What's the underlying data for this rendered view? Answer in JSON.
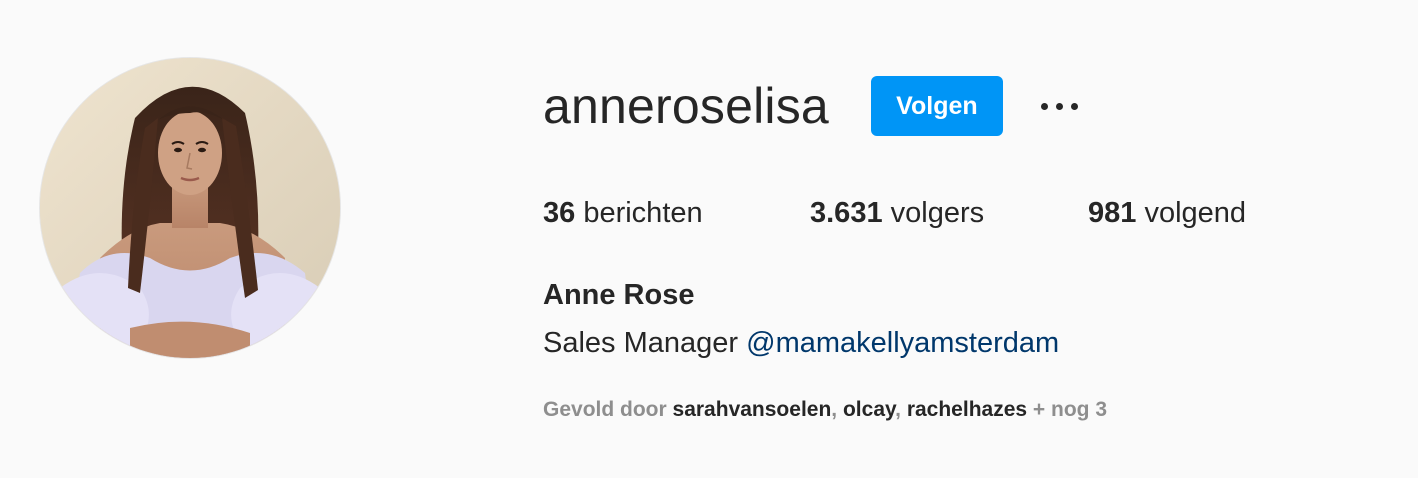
{
  "profile": {
    "username": "anneroselisa",
    "follow_label": "Volgen",
    "full_name": "Anne Rose",
    "bio_text": "Sales Manager",
    "bio_mention": "@mamakellyamsterdam",
    "avatar_alt": "anneroselisa profile picture"
  },
  "stats": {
    "posts_count": "36",
    "posts_label": "berichten",
    "followers_count": "3.631",
    "followers_label": "volgers",
    "following_count": "981",
    "following_label": "volgend"
  },
  "followed_by": {
    "prefix": "Gevold door",
    "accounts": [
      "sarahvansoelen",
      "olcay",
      "rachelhazes"
    ],
    "separator": ",",
    "more": "+ nog 3"
  },
  "colors": {
    "background": "#fafafa",
    "primary_text": "#262626",
    "secondary_text": "#8e8e8e",
    "follow_button": "#0095f6",
    "mention_link": "#00376b"
  },
  "icons": {
    "more_options": "more-horizontal-icon"
  }
}
